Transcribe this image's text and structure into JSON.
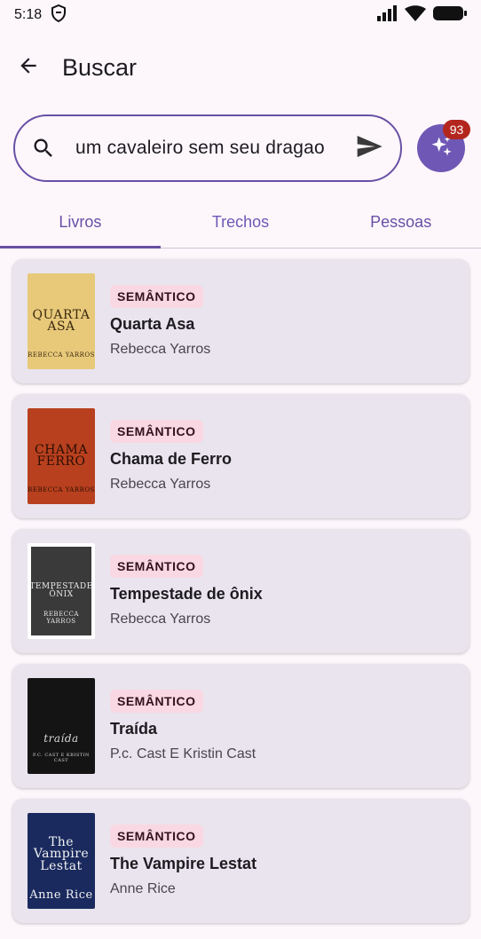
{
  "status_bar": {
    "time": "5:18"
  },
  "app_bar": {
    "title": "Buscar"
  },
  "search": {
    "value": "um cavaleiro sem seu dragao"
  },
  "ai_button": {
    "badge_count": "93"
  },
  "tabs": [
    {
      "label": "Livros",
      "active": true
    },
    {
      "label": "Trechos",
      "active": false
    },
    {
      "label": "Pessoas",
      "active": false
    }
  ],
  "books": [
    {
      "tag": "SEMÂNTICO",
      "title": "Quarta Asa",
      "author": "Rebecca Yarros",
      "cover": {
        "title_lines": "QUARTA\nASA",
        "author": "REBECCA YARROS",
        "bg": "#e8c97a",
        "fg": "#3b2a10"
      }
    },
    {
      "tag": "SEMÂNTICO",
      "title": "Chama de Ferro",
      "author": "Rebecca Yarros",
      "cover": {
        "title_lines": "CHAMA\nFERRO",
        "author": "REBECCA YARROS",
        "bg": "#b8401e",
        "fg": "#2a0e05"
      }
    },
    {
      "tag": "SEMÂNTICO",
      "title": "Tempestade de ônix",
      "author": "Rebecca Yarros",
      "cover": {
        "title_lines": "TEMPESTADE\nÔNIX",
        "author": "REBECCA YARROS",
        "bg": "#3a3a3a",
        "fg": "#e8e8e8"
      }
    },
    {
      "tag": "SEMÂNTICO",
      "title": "Traída",
      "author": "P.c. Cast E Kristin Cast",
      "cover": {
        "title_lines": "traída",
        "author": "P.C. CAST E KRISTIN CAST",
        "bg": "#141414",
        "fg": "#d8d8d8"
      }
    },
    {
      "tag": "SEMÂNTICO",
      "title": "The Vampire Lestat",
      "author": "Anne Rice",
      "cover": {
        "title_lines": "The\nVampire\nLestat",
        "author": "Anne Rice",
        "bg": "#1a2a5e",
        "fg": "#f2f2f2"
      }
    }
  ]
}
